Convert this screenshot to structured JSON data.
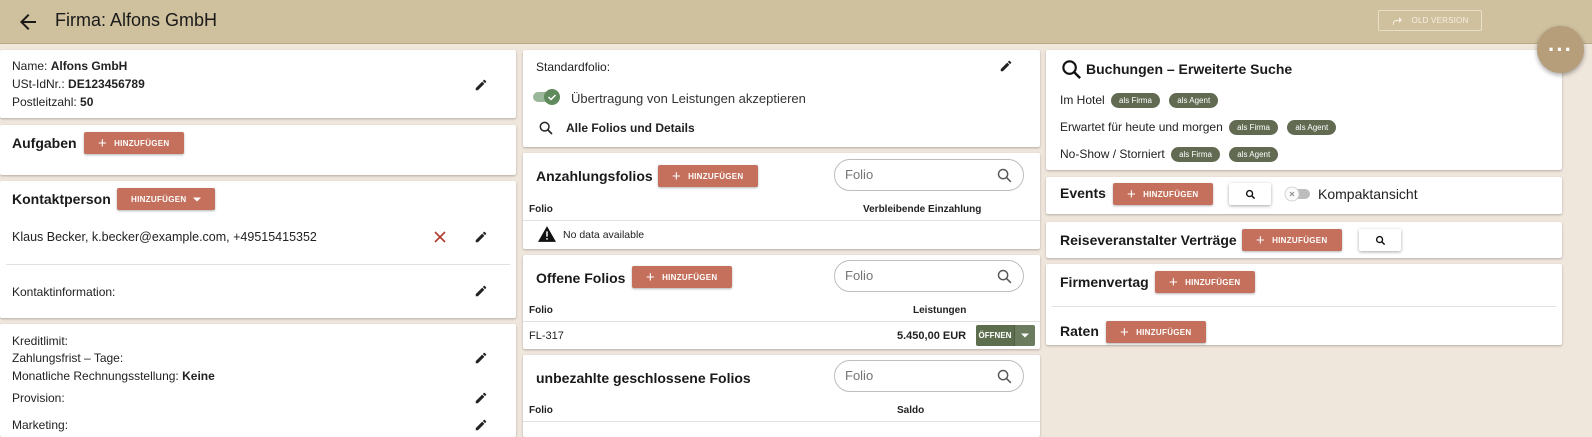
{
  "header": {
    "title": "Firma: Alfons GmbH",
    "old_version_label": "OLD VERSION"
  },
  "company": {
    "name_label": "Name:",
    "name_value": "Alfons GmbH",
    "vat_label": "USt-IdNr.:",
    "vat_value": "DE123456789",
    "zip_label": "Postleitzahl:",
    "zip_value": "50"
  },
  "tasks": {
    "title": "Aufgaben",
    "add_label": "HINZUFÜGEN"
  },
  "contact": {
    "title": "Kontaktperson",
    "add_label": "HINZUFÜGEN",
    "person": "Klaus Becker, k.becker@example.com, +49515415352",
    "info_label": "Kontaktinformation:"
  },
  "finance": {
    "credit_label": "Kreditlimit:",
    "payment_label": "Zahlungsfrist – Tage:",
    "monthly_label": "Monatliche Rechnungsstellung:",
    "monthly_value": "Keine",
    "commission_label": "Provision:",
    "marketing_label": "Marketing:"
  },
  "folio_settings": {
    "standard_label": "Standardfolio:",
    "transfer_label": "Übertragung von Leistungen akzeptieren",
    "transfer_on": true,
    "all_folios_label": "Alle Folios und Details"
  },
  "deposit_folios": {
    "title": "Anzahlungsfolios",
    "add_label": "HINZUFÜGEN",
    "search_placeholder": "Folio",
    "col_folio": "Folio",
    "col_remaining": "Verbleibende Einzahlung",
    "empty_text": "No data available"
  },
  "open_folios": {
    "title": "Offene Folios",
    "add_label": "HINZUFÜGEN",
    "search_placeholder": "Folio",
    "col_folio": "Folio",
    "col_services": "Leistungen",
    "rows": [
      {
        "folio": "FL-317",
        "amount": "5.450,00 EUR",
        "action": "ÖFFNEN"
      }
    ]
  },
  "unpaid_folios": {
    "title": "unbezahlte geschlossene Folios",
    "search_placeholder": "Folio",
    "col_folio": "Folio",
    "col_balance": "Saldo"
  },
  "bookings": {
    "title": "Buchungen – Erweiterte Suche",
    "rows": [
      {
        "label": "Im Hotel",
        "chip_firma": "als Firma",
        "chip_agent": "als Agent"
      },
      {
        "label": "Erwartet für heute und morgen",
        "chip_firma": "als Firma",
        "chip_agent": "als Agent"
      },
      {
        "label": "No-Show / Storniert",
        "chip_firma": "als Firma",
        "chip_agent": "als Agent"
      }
    ]
  },
  "events": {
    "title": "Events",
    "add_label": "HINZUFÜGEN",
    "compact_label": "Kompaktansicht",
    "compact_on": false
  },
  "tour_contracts": {
    "title": "Reiseveranstalter Verträge",
    "add_label": "HINZUFÜGEN"
  },
  "company_contract": {
    "title": "Firmenvertag",
    "add_label": "HINZUFÜGEN"
  },
  "rates": {
    "title": "Raten",
    "add_label": "HINZUFÜGEN"
  },
  "colors": {
    "header": "#cfc09e",
    "accent": "#c4705c",
    "chip": "#626b52",
    "background": "#efe6dc",
    "toggle_on": "#5f8a5c",
    "fab": "#b59e79"
  }
}
